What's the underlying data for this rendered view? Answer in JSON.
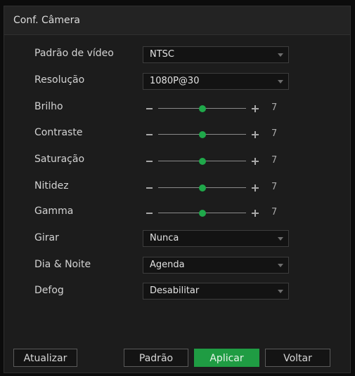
{
  "dialog": {
    "title": "Conf. Câmera"
  },
  "fields": {
    "video_standard": {
      "label": "Padrão de vídeo",
      "value": "NTSC"
    },
    "resolution": {
      "label": "Resolução",
      "value": "1080P@30"
    },
    "brightness": {
      "label": "Brilho",
      "value": "7",
      "level": 0.5
    },
    "contrast": {
      "label": "Contraste",
      "value": "7",
      "level": 0.5
    },
    "saturation": {
      "label": "Saturação",
      "value": "7",
      "level": 0.5
    },
    "sharpness": {
      "label": "Nitidez",
      "value": "7",
      "level": 0.5
    },
    "gamma": {
      "label": "Gamma",
      "value": "7",
      "level": 0.5
    },
    "rotate": {
      "label": "Girar",
      "value": "Nunca"
    },
    "day_night": {
      "label": "Dia & Noite",
      "value": "Agenda"
    },
    "defog": {
      "label": "Defog",
      "value": "Desabilitar"
    }
  },
  "buttons": {
    "refresh": "Atualizar",
    "default": "Padrão",
    "apply": "Aplicar",
    "back": "Voltar"
  },
  "colors": {
    "accent": "#1f9c43",
    "background": "#1c1c1c"
  },
  "icons": {
    "minus": "minus-icon",
    "plus": "plus-icon",
    "caret": "chevron-down-icon"
  }
}
